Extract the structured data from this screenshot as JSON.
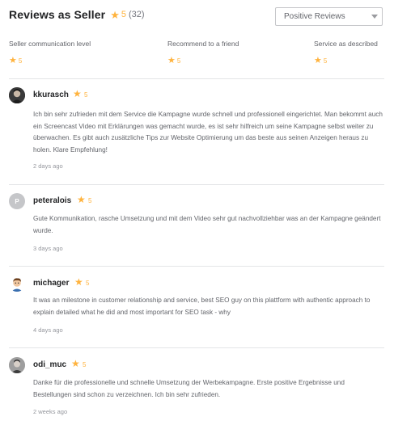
{
  "header": {
    "title": "Reviews as Seller",
    "rating": "5",
    "count": "(32)"
  },
  "filter": {
    "selected": "Positive Reviews"
  },
  "breakdown": [
    {
      "label": "Seller communication level",
      "value": "5"
    },
    {
      "label": "Recommend to a friend",
      "value": "5"
    },
    {
      "label": "Service as described",
      "value": "5"
    }
  ],
  "reviews": [
    {
      "username": "kkurasch",
      "rating": "5",
      "avatar": "photo",
      "text": "Ich bin sehr zufrieden mit dem Service die Kampagne wurde schnell und professionell eingerichtet. Man bekommt auch ein Screencast Video mit Erklärungen was gemacht wurde, es ist sehr hilfreich um seine Kampagne selbst weiter zu überwachen. Es gibt auch zusätzliche Tips zur Website Optimierung um das beste aus seinen Anzeigen heraus zu holen. Klare Empfehlung!",
      "time": "2 days ago"
    },
    {
      "username": "peteralois",
      "rating": "5",
      "avatar_letter": "P",
      "text": "Gute Kommunikation, rasche Umsetzung und mit dem Video sehr gut nachvollziehbar was an der Kampagne geändert wurde.",
      "time": "3 days ago"
    },
    {
      "username": "michager",
      "rating": "5",
      "avatar": "cartoon",
      "text": "It was an milestone in customer relationship and service, best SEO guy on this plattform with authentic approach to explain detailed what he did and most important for SEO task - why",
      "time": "4 days ago"
    },
    {
      "username": "odi_muc",
      "rating": "5",
      "avatar": "photo",
      "text": "Danke für die professionelle und schnelle Umsetzung der Werbekampagne. Erste positive Ergebnisse und Bestellungen sind schon zu verzeichnen. Ich bin sehr zufrieden.",
      "time": "2 weeks ago"
    }
  ],
  "colors": {
    "star": "#ffb33e",
    "divider": "#e4e5e7",
    "text": "#62646a",
    "muted": "#95979d"
  }
}
